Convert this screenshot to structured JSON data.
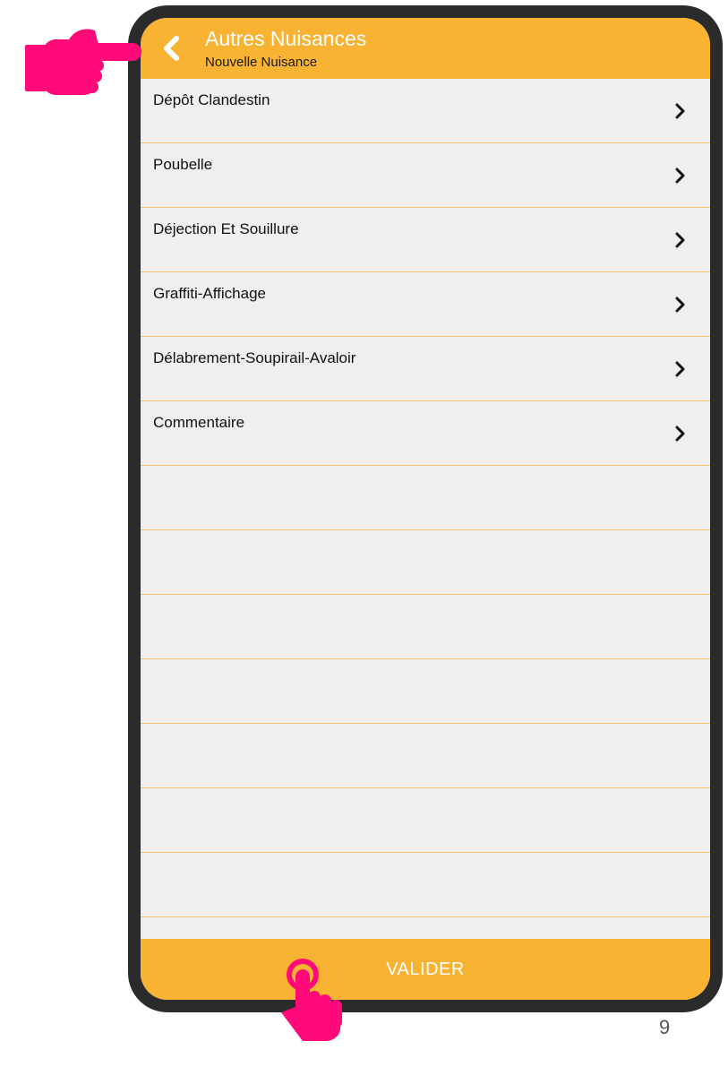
{
  "header": {
    "title": "Autres Nuisances",
    "subtitle": "Nouvelle Nuisance",
    "back_icon": "chevron-left-icon"
  },
  "list": {
    "items": [
      {
        "label": "Dépôt Clandestin",
        "icon": "chevron-right-icon"
      },
      {
        "label": "Poubelle",
        "icon": "chevron-right-icon"
      },
      {
        "label": "Déjection Et Souillure",
        "icon": "chevron-right-icon"
      },
      {
        "label": "Graffiti-Affichage",
        "icon": "chevron-right-icon"
      },
      {
        "label": "Délabrement-Soupirail-Avaloir",
        "icon": "chevron-right-icon"
      },
      {
        "label": "Commentaire",
        "icon": "chevron-right-icon"
      }
    ],
    "empty_rows": 8
  },
  "footer": {
    "validate_label": "VALIDER"
  },
  "annotations": {
    "pointer_back": "pointing-hand-icon",
    "pointer_validate": "tap-hand-icon"
  },
  "page": {
    "number": "9"
  },
  "colors": {
    "accent": "#f8b332",
    "divider": "#f1c36a",
    "list_bg": "#efefef",
    "frame": "#2b2b2b",
    "pointer": "#ff0a78"
  }
}
